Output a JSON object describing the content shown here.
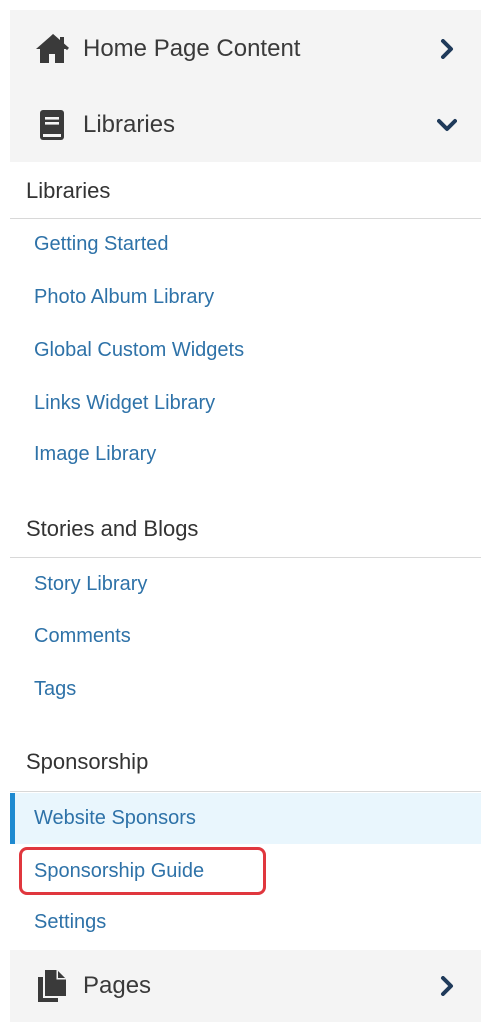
{
  "menu": {
    "home": {
      "label": "Home Page Content",
      "icon": "home-icon",
      "chevron": "chevron-right-icon"
    },
    "libraries": {
      "label": "Libraries",
      "icon": "book-icon",
      "chevron": "chevron-down-icon"
    },
    "pages": {
      "label": "Pages",
      "icon": "pages-icon",
      "chevron": "chevron-right-icon"
    }
  },
  "sections": [
    {
      "title": "Libraries",
      "items": [
        "Getting Started",
        "Photo Album Library",
        "Global Custom Widgets",
        "Links Widget Library",
        "Image Library"
      ]
    },
    {
      "title": "Stories and Blogs",
      "items": [
        "Story Library",
        "Comments",
        "Tags"
      ]
    },
    {
      "title": "Sponsorship",
      "items": [
        "Website Sponsors",
        "Sponsorship Guide",
        "Settings"
      ]
    }
  ],
  "active_item": "Website Sponsors",
  "highlighted_item": "Sponsorship Guide",
  "colors": {
    "link": "#2e72a8",
    "active_bg": "#e9f6fd",
    "active_border": "#1f8ad0",
    "highlight_border": "#e0373e",
    "header_bg": "#f4f4f4"
  }
}
